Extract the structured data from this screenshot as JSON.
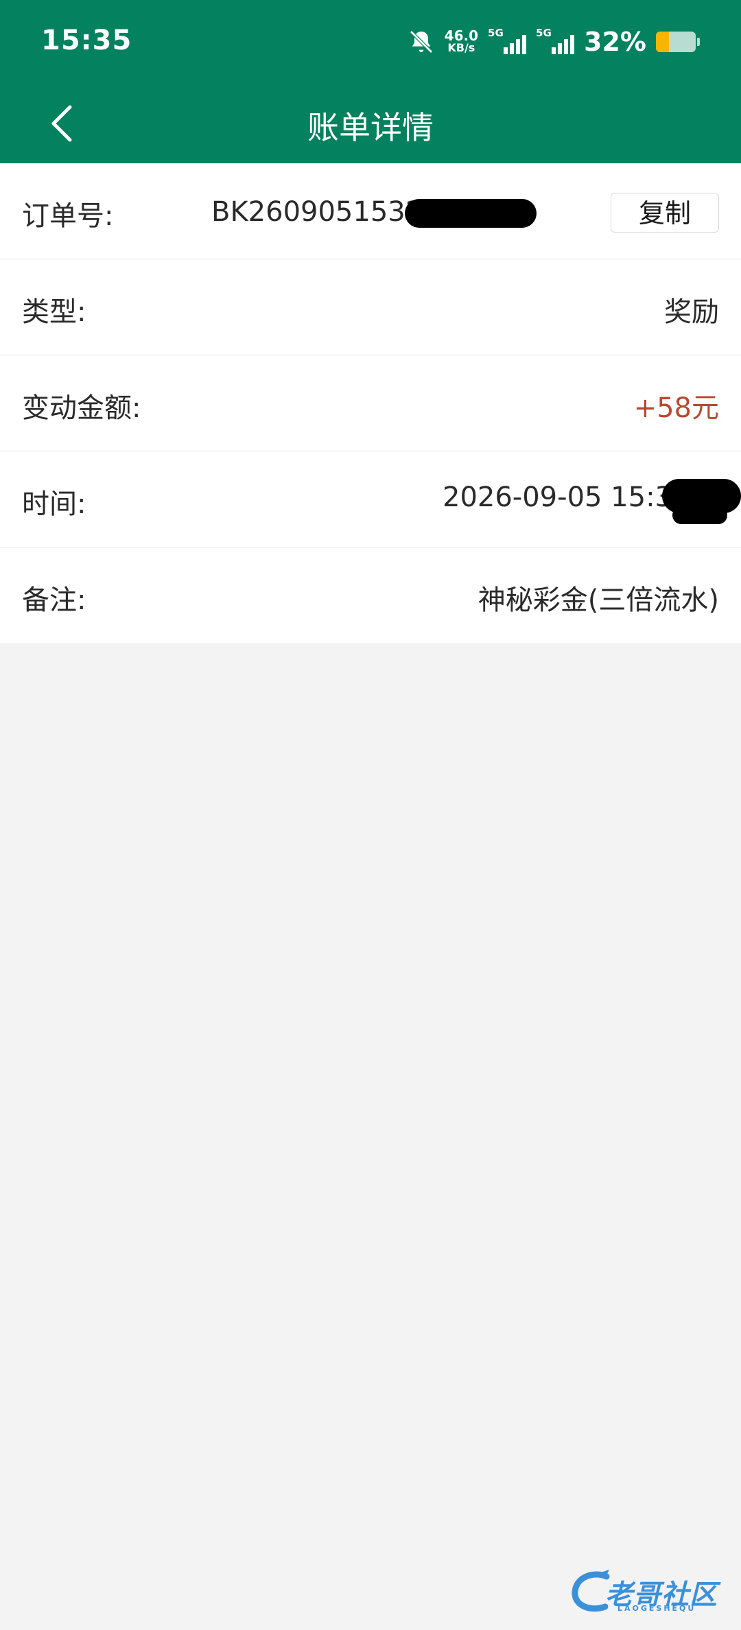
{
  "status_bar": {
    "time": "15:35",
    "net_speed_value": "46.0",
    "net_speed_unit": "KB/s",
    "sim1_type": "5G",
    "sim2_type": "5G",
    "battery_percent_text": "32%",
    "battery_level": 0.32,
    "icons": [
      "bell-off-icon",
      "signal-icon",
      "signal-icon",
      "battery-icon"
    ]
  },
  "header": {
    "title": "账单详情",
    "back_icon": "chevron-left-icon"
  },
  "details": {
    "order_no": {
      "label": "订单号:",
      "value": "BK2609051532",
      "copy_label": "复制"
    },
    "type": {
      "label": "类型:",
      "value": "奖励"
    },
    "amount": {
      "label": "变动金额:",
      "value": "+58元"
    },
    "time": {
      "label": "时间:",
      "value": "2026-09-05 15:3"
    },
    "remark": {
      "label": "备注:",
      "value": "神秘彩金(三倍流水)"
    }
  },
  "watermark": {
    "text": "老哥社区",
    "subtext": "LAOGESHEQU"
  },
  "colors": {
    "header_bg": "#04815f",
    "page_bg": "#f3f3f3",
    "amount_red": "#b54a30",
    "battery_fill": "#f7b500",
    "watermark_blue": "#1c7fd6"
  }
}
